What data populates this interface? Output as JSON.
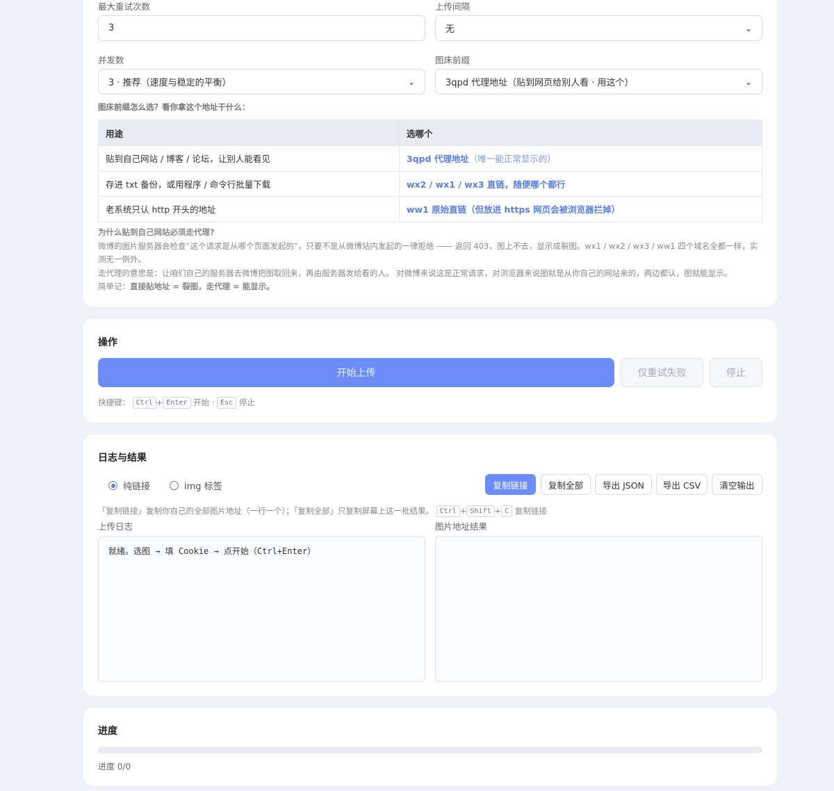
{
  "settings": {
    "max_retry_label": "最大重试次数",
    "max_retry_value": "3",
    "interval_label": "上传间隔",
    "interval_value": "无",
    "concurrency_label": "并发数",
    "concurrency_value": "3 · 推荐（速度与稳定的平衡）",
    "prefix_label": "图床前缀",
    "prefix_value": "3qpd 代理地址（贴到网页给别人看 · 用这个）",
    "prefix_help": "图床前缀怎么选？看你拿这个地址干什么：",
    "table": {
      "headers": [
        "用途",
        "选哪个"
      ],
      "rows": [
        {
          "use": "贴到自己网站 / 博客 / 论坛，让别人能看见",
          "pick_strong": "3qpd 代理地址",
          "pick_rest": "（唯一能正常显示的）"
        },
        {
          "use": "存进 txt 备份，或用程序 / 命令行批量下载",
          "pick_strong": "",
          "pick_rest": "wx2 / wx1 / wx3 直链，随便哪个都行"
        },
        {
          "use": "老系统只认 http 开头的地址",
          "pick_strong": "",
          "pick_rest": "ww1 原始直链（但放进 https 网页会被浏览器拦掉）"
        }
      ]
    },
    "notes": {
      "heading": "为什么贴到自己网站必须走代理?",
      "p1": "微博的图片服务器会检查“这个请求是从哪个页面发起的”，只要不是从微博站内发起的一律拒绝 —— 返回 403，图上不去，显示成裂图。wx1 / wx2 / wx3 / ww1 四个域名全都一样，实测无一例外。",
      "p2": "走代理的意思是：让咱们自己的服务器去微博把图取回来，再由服务器发给看的人。 对微博来说这是正常请求，对浏览器来说图就是从你自己的网站来的，两边都认，图就能显示。",
      "p3_prefix": "简单记：",
      "p3_bold": "直接贴地址 = 裂图，走代理 = 能显示。"
    }
  },
  "actions": {
    "title": "操作",
    "start_label": "开始上传",
    "retry_label": "仅重试失败",
    "stop_label": "停止",
    "shortcut_prefix": "快捷键：",
    "key_ctrl": "Ctrl",
    "key_enter": "Enter",
    "start_word": "开始 ·",
    "key_esc": "Esc",
    "stop_word": "停止",
    "plus": "+"
  },
  "log": {
    "title": "日志与结果",
    "radio_plain": "纯链接",
    "radio_img": "img 标签",
    "btn_copy_links": "复制链接",
    "btn_copy_all": "复制全部",
    "btn_export_json": "导出 JSON",
    "btn_export_csv": "导出 CSV",
    "btn_clear": "清空输出",
    "help_text": "「复制链接」复制你自己的全部图片地址（一行一个）；「复制全部」只复制屏幕上这一批结果。",
    "key_ctrl": "Ctrl",
    "key_shift": "Shift",
    "key_c": "C",
    "help_suffix": "复制链接",
    "plus": "+",
    "upload_log_label": "上传日志",
    "upload_log_text": "就绪。选图 → 填 Cookie → 点开始（Ctrl+Enter）",
    "result_label": "图片地址结果",
    "result_text": ""
  },
  "progress": {
    "title": "进度",
    "fraction": 0,
    "text": "进度 0/0"
  }
}
